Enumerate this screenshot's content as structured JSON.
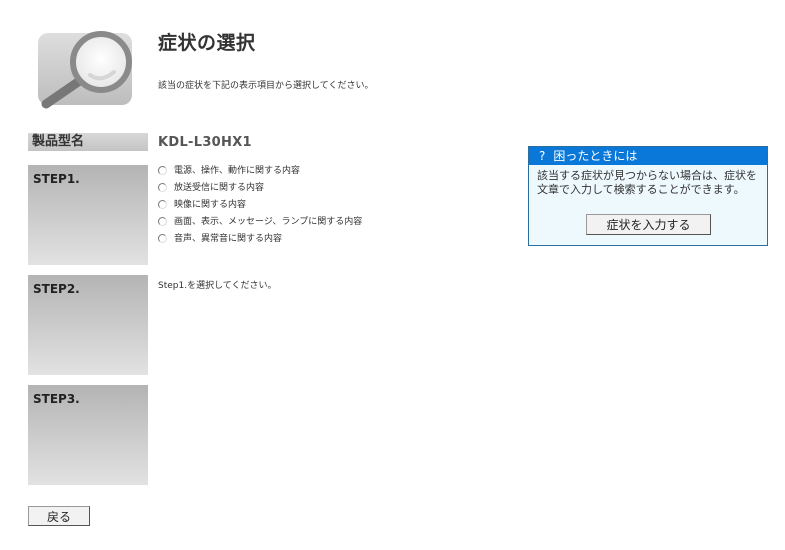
{
  "header": {
    "title": "症状の選択",
    "description": "該当の症状を下記の表示項目から選択してください。",
    "logo_icon": "magnifier-icon"
  },
  "product": {
    "label": "製品型名",
    "model": "KDL-L30HX1"
  },
  "steps": [
    {
      "label": "STEP1.",
      "options": [
        "電源、操作、動作に関する内容",
        "放送受信に関する内容",
        "映像に関する内容",
        "画面、表示、メッセージ、ランプに関する内容",
        "音声、異常音に関する内容"
      ]
    },
    {
      "label": "STEP2.",
      "message": "Step1.を選択してください。"
    },
    {
      "label": "STEP3."
    }
  ],
  "help": {
    "icon": "?",
    "title": "困ったときには",
    "text": "該当する症状が見つからない場合は、症状を文章で入力して検索することができます。",
    "button_label": "症状を入力する"
  },
  "back_button_label": "戻る",
  "colors": {
    "help_header": "#0a78d8",
    "help_border": "#2a6f9e",
    "help_background": "#eef9fd"
  }
}
